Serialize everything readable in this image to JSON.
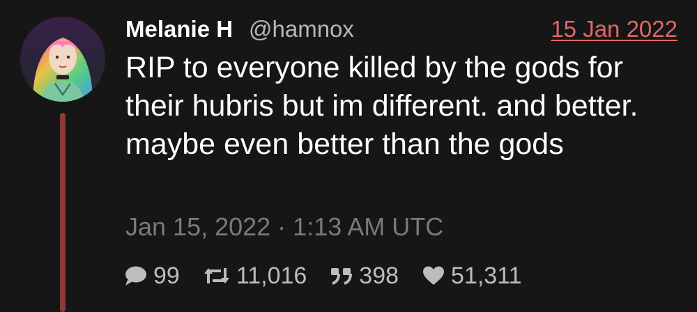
{
  "tweet": {
    "author": {
      "name": "Melanie H",
      "handle": "@hamnox",
      "avatar_icon": "avatar-illustration"
    },
    "date_link": "15 Jan 2022",
    "text": "RIP to everyone killed by the gods for their hubris but im different. and better. maybe even better than the gods",
    "timestamp": "Jan 15, 2022 · 1:13 AM UTC",
    "stats": {
      "replies": "99",
      "retweets": "11,016",
      "quotes": "398",
      "likes": "51,311"
    },
    "icons": {
      "replies": "comment-icon",
      "retweets": "retweet-icon",
      "quotes": "quote-icon",
      "likes": "heart-icon"
    },
    "colors": {
      "background": "#161616",
      "text": "#ffffff",
      "muted": "#7a7a7a",
      "link": "#e06767",
      "thread_line": "#8c3a3a"
    }
  }
}
